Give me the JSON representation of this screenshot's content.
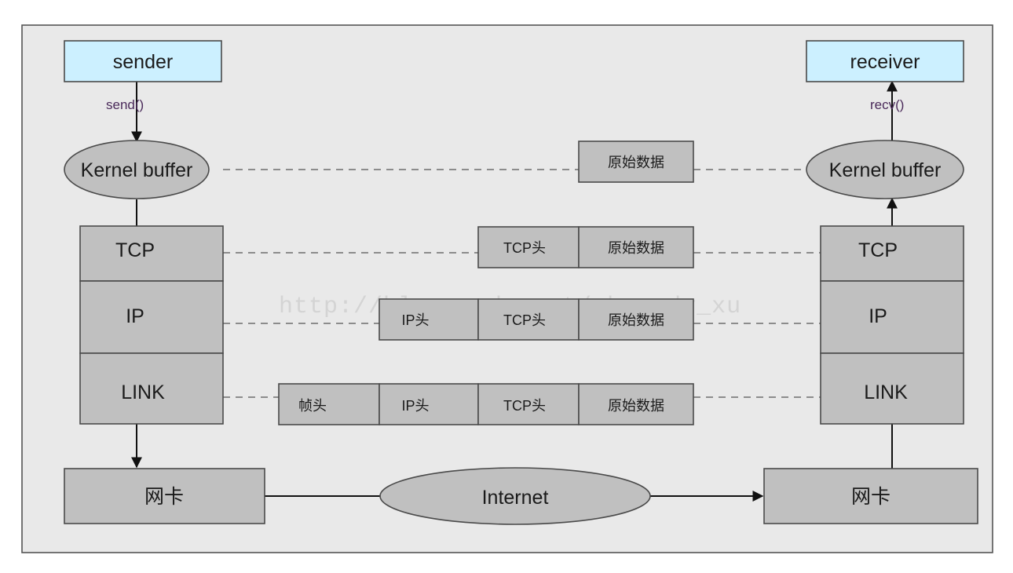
{
  "nodes": {
    "sender": "sender",
    "receiver": "receiver",
    "send_call": "send()",
    "recv_call": "recv()",
    "kernel_buffer": "Kernel buffer",
    "tcp": "TCP",
    "ip": "IP",
    "link": "LINK",
    "nic": "网卡",
    "internet": "Internet"
  },
  "packet": {
    "raw_data": "原始数据",
    "tcp_header": "TCP头",
    "ip_header": "IP头",
    "frame_header": "帧头"
  },
  "watermark": "http://blog.csdn.net/shanady_xu",
  "colors": {
    "panel": "#e9e9e9",
    "app_box": "#ccf0ff",
    "layer_box": "#c0c0c0",
    "border": "#4a4a4a"
  }
}
